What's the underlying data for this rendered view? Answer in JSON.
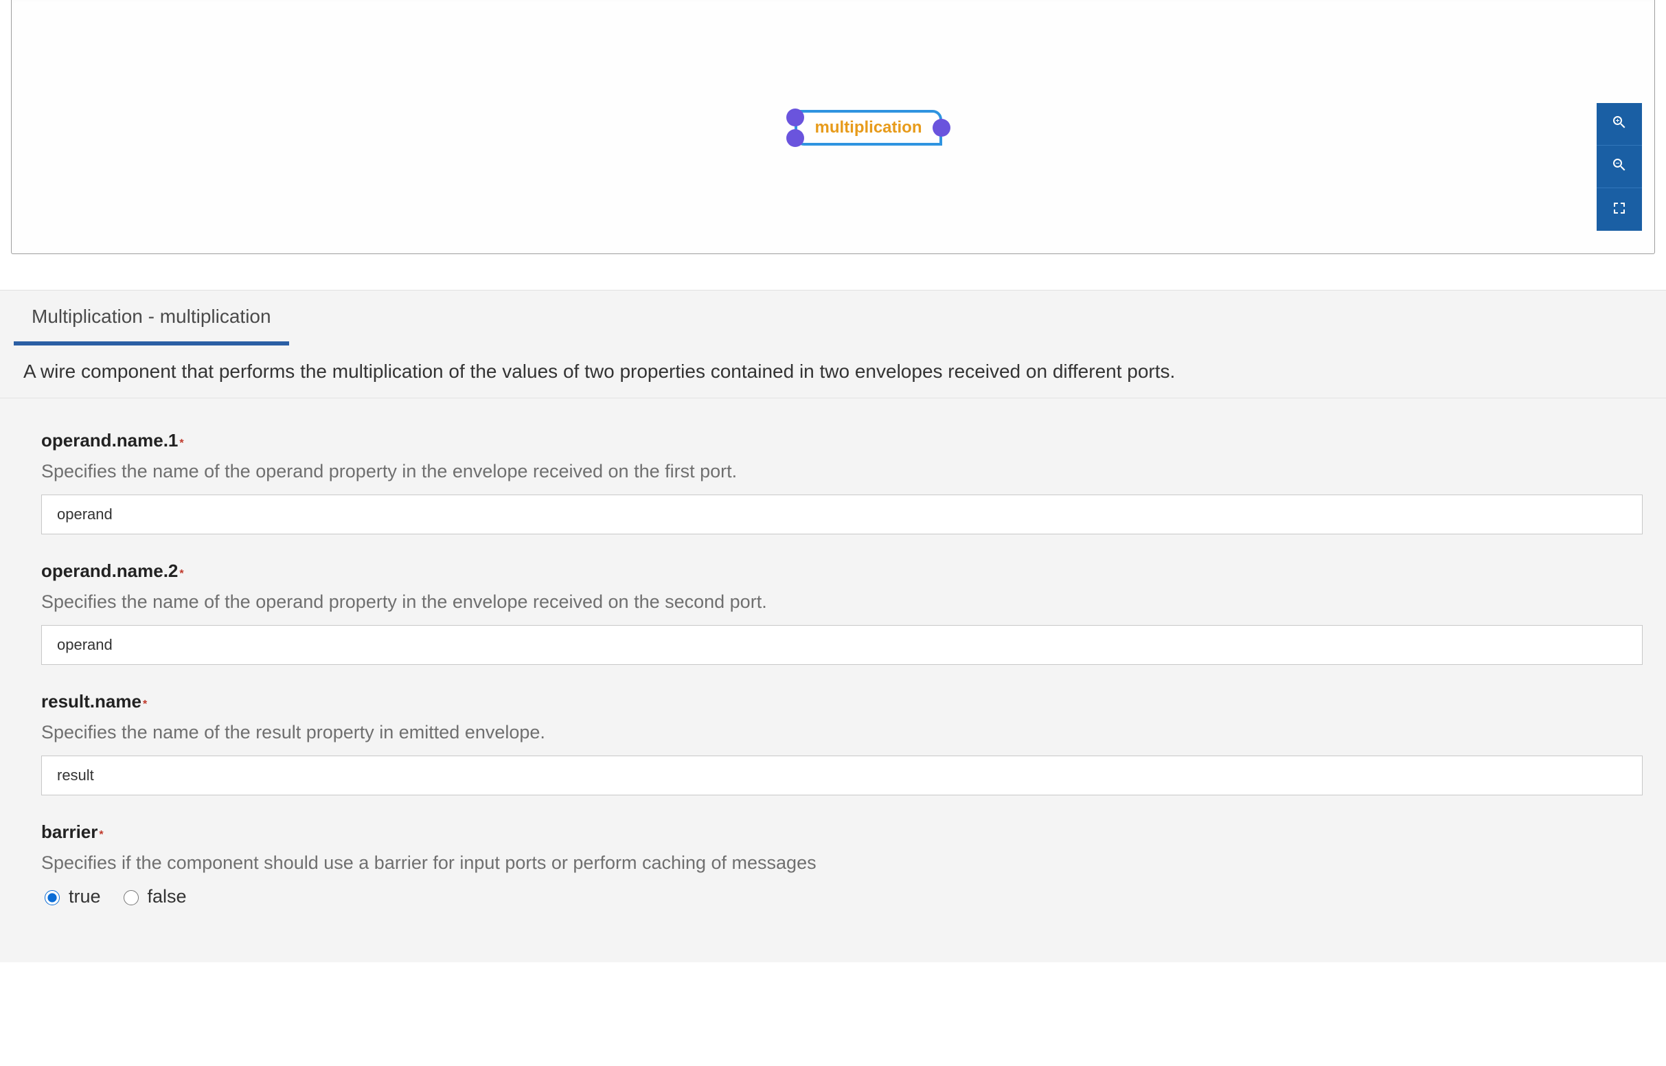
{
  "canvas": {
    "node_label": "multiplication",
    "zoom": {
      "in_title": "Zoom in",
      "out_title": "Zoom out",
      "fit_title": "Fit to screen"
    }
  },
  "panel": {
    "tab_label": "Multiplication - multiplication",
    "description": "A wire component that performs the multiplication of the values of two properties contained in two envelopes received on different ports."
  },
  "fields": {
    "operand1": {
      "label": "operand.name.1",
      "required_marker": "*",
      "description": "Specifies the name of the operand property in the envelope received on the first port.",
      "value": "operand"
    },
    "operand2": {
      "label": "operand.name.2",
      "required_marker": "*",
      "description": "Specifies the name of the operand property in the envelope received on the second port.",
      "value": "operand"
    },
    "result": {
      "label": "result.name",
      "required_marker": "*",
      "description": "Specifies the name of the result property in emitted envelope.",
      "value": "result"
    },
    "barrier": {
      "label": "barrier",
      "required_marker": "*",
      "description": "Specifies if the component should use a barrier for input ports or perform caching of messages",
      "option_true": "true",
      "option_false": "false",
      "selected": "true"
    }
  }
}
